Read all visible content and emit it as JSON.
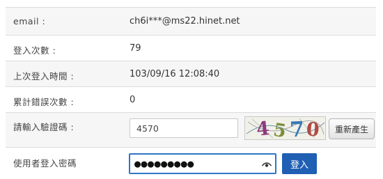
{
  "form": {
    "email": {
      "label": "email :",
      "value": "ch6i***@ms22.hinet.net"
    },
    "login_count": {
      "label": "登入次數 :",
      "value": "79"
    },
    "last_login": {
      "label": "上次登入時間 :",
      "value": "103/09/16 12:08:40"
    },
    "error_count": {
      "label": "累計錯誤次數 :",
      "value": "0"
    },
    "captcha": {
      "label": "請輸入驗證碼 :",
      "input_value": "4570",
      "image_text": "4570",
      "regenerate_label": "重新產生"
    },
    "password": {
      "label": "使用者登入密碼",
      "masked_value": "●●●●●●●●●",
      "login_label": "登入",
      "toggle_icon": "eye-icon"
    }
  },
  "colors": {
    "accent": "#2e76c6",
    "login_button": "#1f5fb4",
    "row_alt": "#f6f6f6",
    "border": "#dcdcdc"
  }
}
